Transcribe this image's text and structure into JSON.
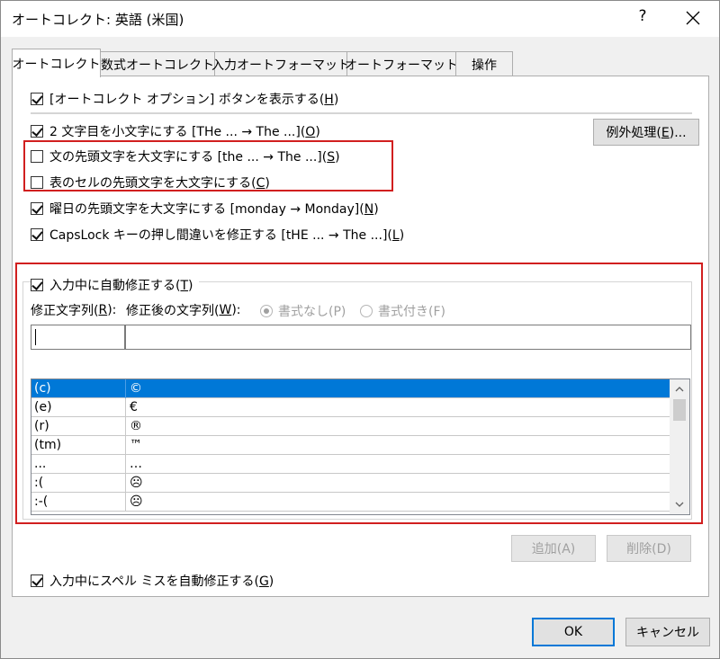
{
  "window": {
    "title": "オートコレクト: 英語 (米国)",
    "help_label": "?"
  },
  "tabs": [
    {
      "label": "オートコレクト",
      "active": true
    },
    {
      "label": "数式オートコレクト",
      "active": false
    },
    {
      "label": "入力オートフォーマット",
      "active": false
    },
    {
      "label": "オートフォーマット",
      "active": false
    },
    {
      "label": "操作",
      "active": false
    }
  ],
  "options": {
    "show_buttons": {
      "checked": true,
      "pre": "[オートコレクト オプション] ボタンを表示する(",
      "key": "H",
      "post": ")"
    },
    "two_initial_caps": {
      "checked": true,
      "pre": "2 文字目を小文字にする [THe ... → The ...](",
      "key": "O",
      "post": ")"
    },
    "capitalize_sentence": {
      "checked": false,
      "pre": "文の先頭文字を大文字にする [the ... → The ...](",
      "key": "S",
      "post": ")"
    },
    "capitalize_table_cells": {
      "checked": false,
      "pre": "表のセルの先頭文字を大文字にする(",
      "key": "C",
      "post": ")"
    },
    "capitalize_days": {
      "checked": true,
      "pre": "曜日の先頭文字を大文字にする [monday →  Monday](",
      "key": "N",
      "post": ")"
    },
    "capslock_fix": {
      "checked": true,
      "pre": "CapsLock キーの押し間違いを修正する [tHE ... → The ...](",
      "key": "L",
      "post": ")"
    }
  },
  "exceptions_button": {
    "pre": "例外処理(",
    "key": "E",
    "post": ")..."
  },
  "replace_section": {
    "replace_as_you_type": {
      "checked": true,
      "pre": "入力中に自動修正する(",
      "key": "T",
      "post": ")"
    },
    "replace_label": {
      "pre": "修正文字列(",
      "key": "R",
      "post": "):"
    },
    "with_label": {
      "pre": "修正後の文字列(",
      "key": "W",
      "post": "):"
    },
    "plain_text": {
      "label": "書式なし(P)",
      "selected": true
    },
    "formatted_text": {
      "label": "書式付き(F)",
      "selected": false
    },
    "replace_value": "",
    "with_value": ""
  },
  "entries": [
    {
      "from": "(c)",
      "to": "©",
      "selected": true
    },
    {
      "from": "(e)",
      "to": "€",
      "selected": false
    },
    {
      "from": "(r)",
      "to": "®",
      "selected": false
    },
    {
      "from": "(tm)",
      "to": "™",
      "selected": false
    },
    {
      "from": "...",
      "to": "…",
      "selected": false
    },
    {
      "from": ":(",
      "to": "☹",
      "selected": false
    },
    {
      "from": ":-(",
      "to": "☹",
      "selected": false
    }
  ],
  "buttons": {
    "add": "追加(A)",
    "delete": "削除(D)",
    "ok": "OK",
    "cancel": "キャンセル"
  },
  "spelling": {
    "checked": true,
    "pre": "入力中にスペル ミスを自動修正する(",
    "key": "G",
    "post": ")"
  },
  "colors": {
    "highlight_red": "#d11f1f",
    "selection_blue": "#0078d7"
  }
}
